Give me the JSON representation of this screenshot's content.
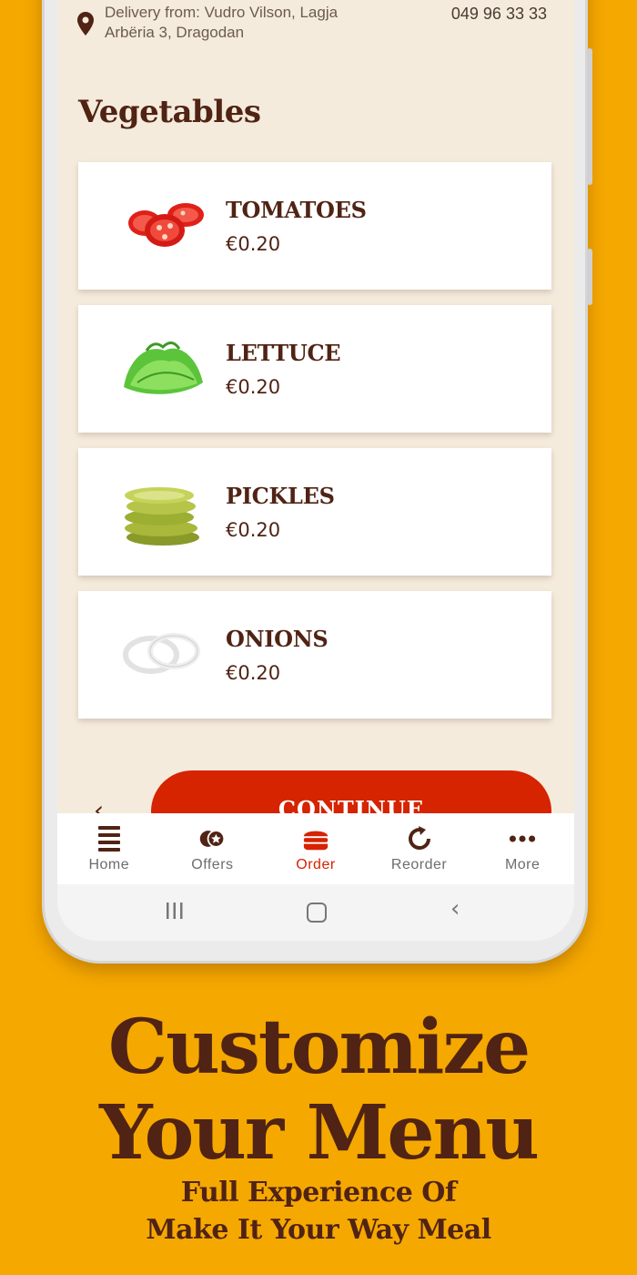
{
  "header": {
    "delivery_line1": "Delivery from: Vudro Vilson, Lagja",
    "delivery_line2": "Arbëria 3, Dragodan",
    "phone": "049 96 33 33",
    "location_icon": "map-pin-icon"
  },
  "section": {
    "title": "Vegetables"
  },
  "items": [
    {
      "name": "TOMATOES",
      "price": "€0.20",
      "image": "tomatoes"
    },
    {
      "name": "LETTUCE",
      "price": "€0.20",
      "image": "lettuce"
    },
    {
      "name": "PICKLES",
      "price": "€0.20",
      "image": "pickles"
    },
    {
      "name": "ONIONS",
      "price": "€0.20",
      "image": "onions"
    }
  ],
  "actions": {
    "continue_label": "CONTINUE",
    "back_icon": "chevron-left-icon"
  },
  "tabs": [
    {
      "label": "Home",
      "icon": "home-icon",
      "active": false
    },
    {
      "label": "Offers",
      "icon": "offers-icon",
      "active": false
    },
    {
      "label": "Order",
      "icon": "burger-icon",
      "active": true
    },
    {
      "label": "Reorder",
      "icon": "refresh-icon",
      "active": false
    },
    {
      "label": "More",
      "icon": "more-dots-icon",
      "active": false
    }
  ],
  "promo": {
    "headline_line1": "Customize",
    "headline_line2": "Your Menu",
    "sub_line1": "Full Experience Of",
    "sub_line2": "Make It Your Way Meal"
  },
  "colors": {
    "background": "#F5A800",
    "brand_brown": "#502314",
    "brand_red": "#D62300",
    "screen_bg": "#F5EBDC"
  }
}
